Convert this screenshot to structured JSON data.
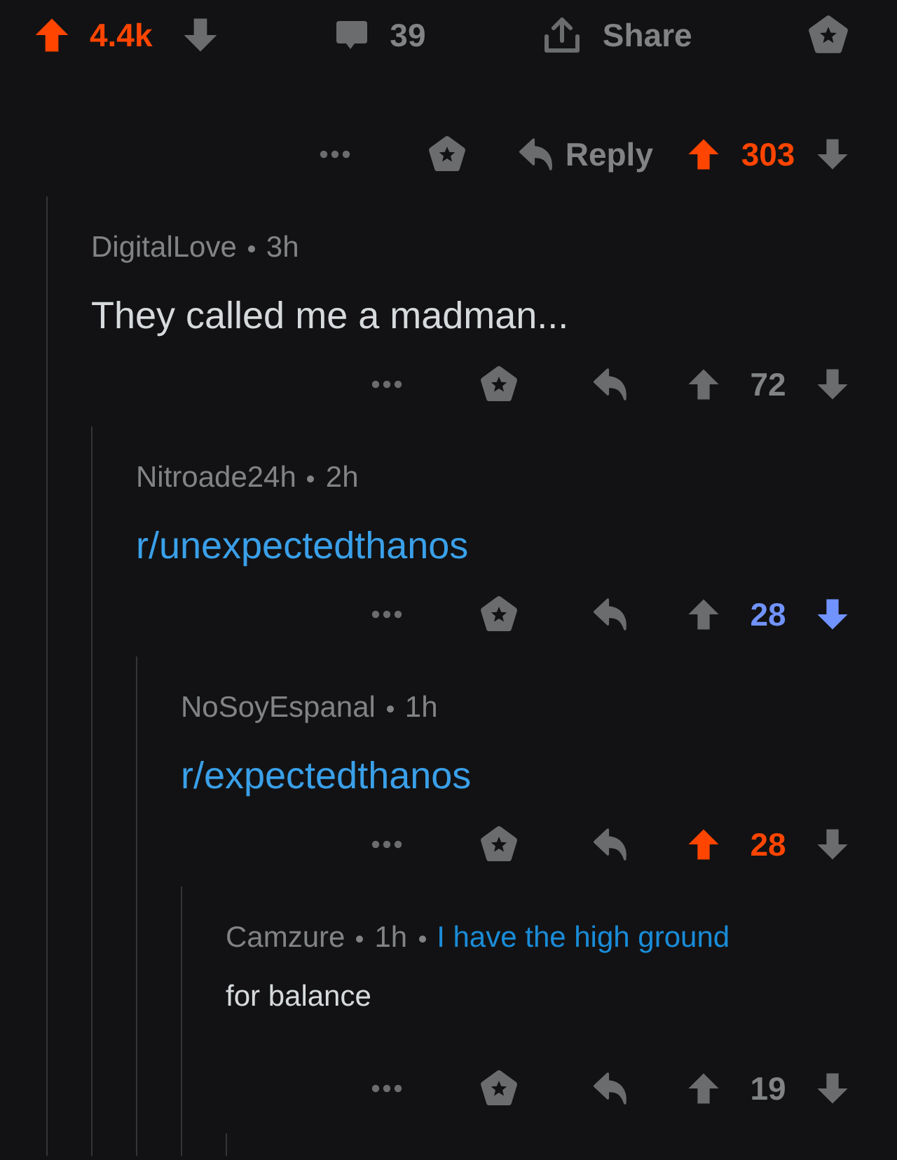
{
  "post_bar": {
    "upvoted": true,
    "downvoted": false,
    "score": "4.4k",
    "comments": "39",
    "share": "Share"
  },
  "top_comment": {
    "reply_label": "Reply",
    "upvoted": true,
    "downvoted": false,
    "score": "303",
    "replies": [
      {
        "author": "DigitalLove",
        "age": "3h",
        "body": {
          "kind": "text",
          "text": "They called me a madman..."
        },
        "upvoted": false,
        "downvoted": false,
        "score": "72",
        "continues": false,
        "replies": [
          {
            "author": "Nitroade24h",
            "age": "2h",
            "body": {
              "kind": "link",
              "text": "r/unexpectedthanos"
            },
            "upvoted": false,
            "downvoted": true,
            "score": "28",
            "continues": false,
            "replies": [
              {
                "author": "NoSoyEspanal",
                "age": "1h",
                "body": {
                  "kind": "link",
                  "text": "r/expectedthanos"
                },
                "upvoted": true,
                "downvoted": false,
                "score": "28",
                "continues": false,
                "replies": [
                  {
                    "author": "Camzure",
                    "age": "1h",
                    "flair": "I have the high ground",
                    "body": {
                      "kind": "note",
                      "text": "for balance"
                    },
                    "upvoted": false,
                    "downvoted": false,
                    "score": "19",
                    "continues": true
                  }
                ]
              }
            ]
          }
        ]
      }
    ]
  }
}
